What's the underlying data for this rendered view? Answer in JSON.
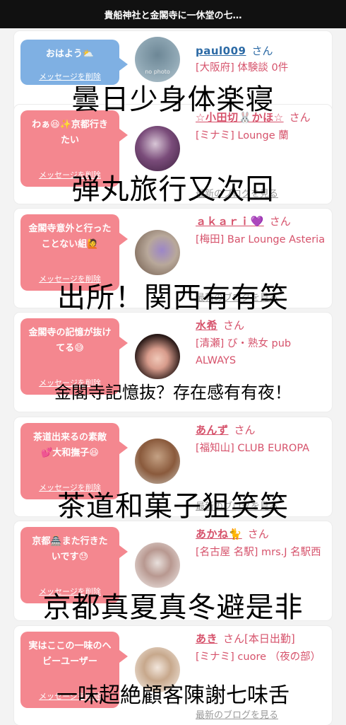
{
  "header": {
    "title": "貴船神社と金閣寺に一休堂の七…"
  },
  "colors": {
    "bubble_pink": "#f4878f",
    "bubble_blue": "#7fb0e3",
    "name_pink": "#d6526b",
    "name_blue": "#2c6aa5"
  },
  "delete_label": "メッセージを削除",
  "honorific": "さん",
  "blog_label": "最新のブログを見る",
  "cards": [
    {
      "message": "おはよう⛅",
      "name": "paul009",
      "area_shop": "[大阪府] 体験談 0件",
      "no_photo": "no photo",
      "bubble": "blue"
    },
    {
      "message": "わぁ😆✨京都行きたい",
      "name": "☆小田切🐰かほ☆",
      "area_shop": "[ミナミ] Lounge 蘭",
      "bubble": "pink"
    },
    {
      "message": "金閣寺意外と行ったことない組🙋",
      "name": "ａｋａｒｉ💜",
      "area_shop": "[梅田] Bar Lounge Asteria",
      "bubble": "pink"
    },
    {
      "message": "金閣寺の記憶が抜けてる😅",
      "name": "水希",
      "area_shop": "[清瀬] び・熟女 pub ALWAYS",
      "bubble": "pink"
    },
    {
      "message": "茶道出来るの素敵💕大和撫子😆",
      "name": "あんず",
      "area_shop": "[福知山] CLUB EUROPA",
      "bubble": "pink"
    },
    {
      "message": "京都🏯また行きたいです😓",
      "name": "あかね🐈",
      "area_shop": "[名古屋 名駅] mrs.J 名駅西",
      "bubble": "pink"
    },
    {
      "message": "実はここの一味のヘビーユーザー",
      "name": "あき",
      "status": "[本日出勤]",
      "area_shop": "[ミナミ] cuore （夜の部）",
      "bubble": "pink"
    }
  ],
  "overlay_texts": [
    "曇日少身体楽寝",
    "弾丸旅行又次回",
    "出所！関西有有笑",
    "金閣寺記憶抜？存在感有有夜！",
    "茶道和菓子狙笑笑",
    "京都真夏真冬避是非",
    "一味超絶顧客陳謝七味舌"
  ]
}
